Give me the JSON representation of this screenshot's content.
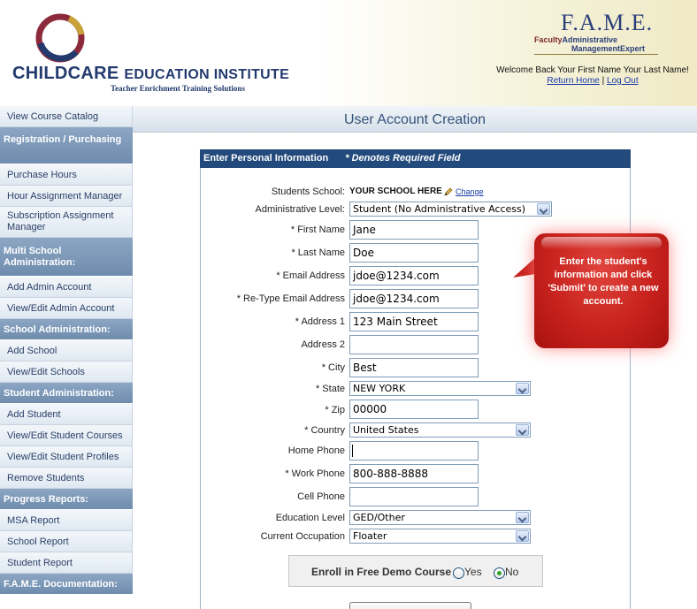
{
  "header": {
    "logo_name_part1": "CHILDCARE",
    "logo_name_part2": "EDUCATION INSTITUTE",
    "logo_tagline": "Teacher Enrichment Training Solutions",
    "fame_title": "F.A.M.E.",
    "fame_sub_line1_a": "Faculty",
    "fame_sub_line1_b": "Administrative",
    "fame_sub_line2": "ManagementExpert",
    "welcome_text": "Welcome Back Your First Name Your Last Name!",
    "return_home_link": "Return Home",
    "separator": "|",
    "logout_link": "Log Out"
  },
  "sidebar": {
    "view_catalog": "View Course Catalog",
    "registration_heading": "Registration / Purchasing",
    "purchase_hours": "Purchase Hours",
    "hour_assignment": "Hour Assignment Manager",
    "subscription_assignment": "Subscription Assignment Manager",
    "multi_school_heading": "Multi School Administration:",
    "add_admin": "Add Admin Account",
    "view_edit_admin": "View/Edit Admin Account",
    "school_admin_heading": "School Administration:",
    "add_school": "Add School",
    "view_edit_schools": "View/Edit Schools",
    "student_admin_heading": "Student Administration:",
    "add_student": "Add Student",
    "view_edit_student_courses": "View/Edit Student Courses",
    "view_edit_student_profiles": "View/Edit Student Profiles",
    "remove_students": "Remove Students",
    "progress_heading": "Progress Reports:",
    "msa_report": "MSA Report",
    "school_report": "School Report",
    "student_report": "Student Report",
    "fame_docs_heading": "F.A.M.E. Documentation:"
  },
  "main": {
    "title": "User Account Creation",
    "section_header": "Enter Personal Information",
    "required_note": "* Denotes Required Field"
  },
  "form": {
    "school_label": "Students School:",
    "school_value": "YOUR SCHOOL HERE",
    "change_link": "Change",
    "admin_level_label": "Administrative Level:",
    "admin_level_value": "Student (No Administrative Access)",
    "first_name_label": "* First Name",
    "first_name_value": "Jane",
    "last_name_label": "* Last Name",
    "last_name_value": "Doe",
    "email_label": "* Email Address",
    "email_value": "jdoe@1234.com",
    "email_retype_label": "* Re-Type Email Address",
    "email_retype_value": "jdoe@1234.com",
    "address1_label": "* Address 1",
    "address1_value": "123 Main Street",
    "address2_label": "Address 2",
    "address2_value": "",
    "city_label": "* City",
    "city_value": "Best",
    "state_label": "* State",
    "state_value": "NEW YORK",
    "zip_label": "* Zip",
    "zip_value": "00000",
    "country_label": "* Country",
    "country_value": "United States",
    "home_phone_label": "Home Phone",
    "home_phone_value": "",
    "work_phone_label": "* Work Phone",
    "work_phone_value": "800-888-8888",
    "cell_phone_label": "Cell Phone",
    "cell_phone_value": "",
    "education_label": "Education Level",
    "education_value": "GED/Other",
    "occupation_label": "Current Occupation",
    "occupation_value": "Floater"
  },
  "callout": {
    "text": "Enter the student's information and click 'Submit' to create a new account."
  },
  "enroll": {
    "label": "Enroll in Free Demo Course",
    "yes": "Yes",
    "no": "No",
    "selected": "No"
  },
  "colors": {
    "header_bar": "#234a7c",
    "sidebar_heading": "#7a96b8",
    "title_text": "#34527a",
    "callout": "#c8221d",
    "link": "#1a3aa8"
  }
}
